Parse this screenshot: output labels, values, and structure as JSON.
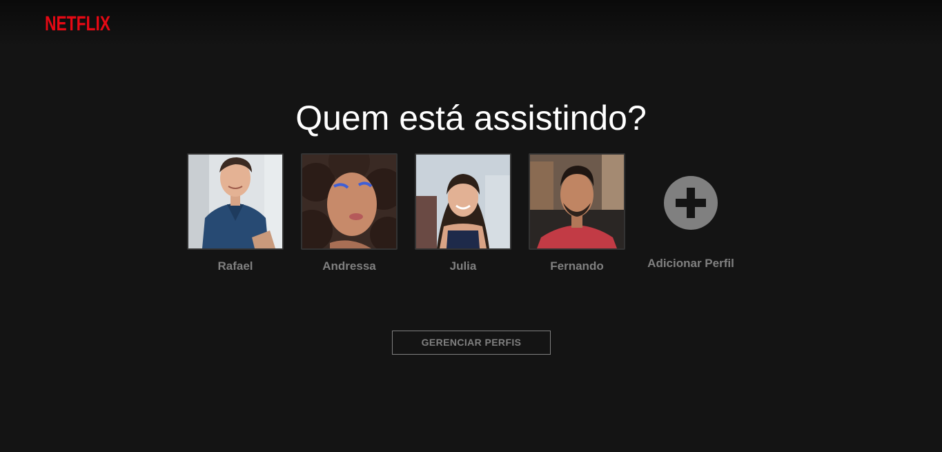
{
  "header": {
    "logo_text": "NETFLIX",
    "logo_color": "#E50914"
  },
  "main": {
    "title": "Quem está assistindo?",
    "profiles": [
      {
        "name": "Rafael",
        "icon": "avatar-photo"
      },
      {
        "name": "Andressa",
        "icon": "avatar-photo"
      },
      {
        "name": "Julia",
        "icon": "avatar-photo"
      },
      {
        "name": "Fernando",
        "icon": "avatar-photo"
      }
    ],
    "add_profile": {
      "label": "Adicionar Perfil",
      "icon": "plus-circle-icon"
    },
    "manage_button": "GERENCIAR PERFIS"
  },
  "colors": {
    "background": "#141414",
    "text_muted": "#808080",
    "title": "#FFFFFF"
  }
}
